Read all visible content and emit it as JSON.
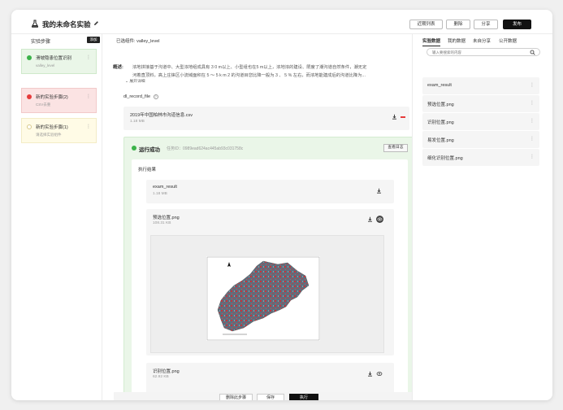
{
  "header": {
    "title": "我的未命名实验",
    "buttons": {
      "recent": "近期列表",
      "delete": "删除",
      "share": "分享",
      "publish": "发布"
    }
  },
  "sidebar": {
    "title": "实验步骤",
    "add_label": "添加",
    "steps": [
      {
        "name": "滑坡隐患位置识别",
        "sub": "valley_level",
        "status": "success"
      },
      {
        "name": "新的实验步骤(2)",
        "sub": "CSV去重",
        "status": "error"
      },
      {
        "name": "新的实验步骤(1)",
        "sub": "请选择实验组件",
        "status": "idle"
      }
    ]
  },
  "main": {
    "component_label": "已选组件:",
    "component_value": "valley_level",
    "overview_label": "概述:",
    "description_line1": "浓地拼接基于沟道中、大型浓地组成具有 3 0 m以上、小型组也在5 m以上，浓地浓的建设、限度了潮沟道自然条件，潮无定",
    "description_line2": "河着直顶料，高上庄徕区小流域面积在 5 ～ 5 k m 2 的沟道目您比降一般为 3 、 5 % 左右，而浓地能建成后的沟道比降为...",
    "expand_label": "展开详细",
    "param_label": "dl_record_file",
    "file_name": "2019年中国柏林市沟道信息.csv",
    "file_size": "1.18 MB",
    "run": {
      "status": "运行成功",
      "task_id": "任务ID：0989ead624ac445ab93c031758c",
      "log_button": "查看日志",
      "results_title": "执行结果",
      "results": [
        {
          "name": "exam_result",
          "size": "1.18 MB"
        },
        {
          "name": "预选位置.png",
          "size": "108.31 KB"
        },
        {
          "name": "识别位置.png",
          "size": "62.92 KB"
        }
      ]
    },
    "actions": {
      "delete_step": "删除此步骤",
      "save": "保存",
      "run": "执行"
    }
  },
  "right": {
    "tabs": [
      "实验数据",
      "我的数据",
      "未自分享",
      "公开数据"
    ],
    "active_tab": 0,
    "search_placeholder": "输入要搜索的内容",
    "items": [
      "exam_result",
      "预选位置.png",
      "识别位置.png",
      "易发位置.png",
      "细化识别位置.png"
    ]
  },
  "colors": {
    "success": "#3cb34a",
    "error": "#e63c3c",
    "success_bg": "#eaf6e8",
    "error_bg": "#fbe3e3",
    "idle_bg": "#fffbe6",
    "primary_dark": "#111111"
  }
}
